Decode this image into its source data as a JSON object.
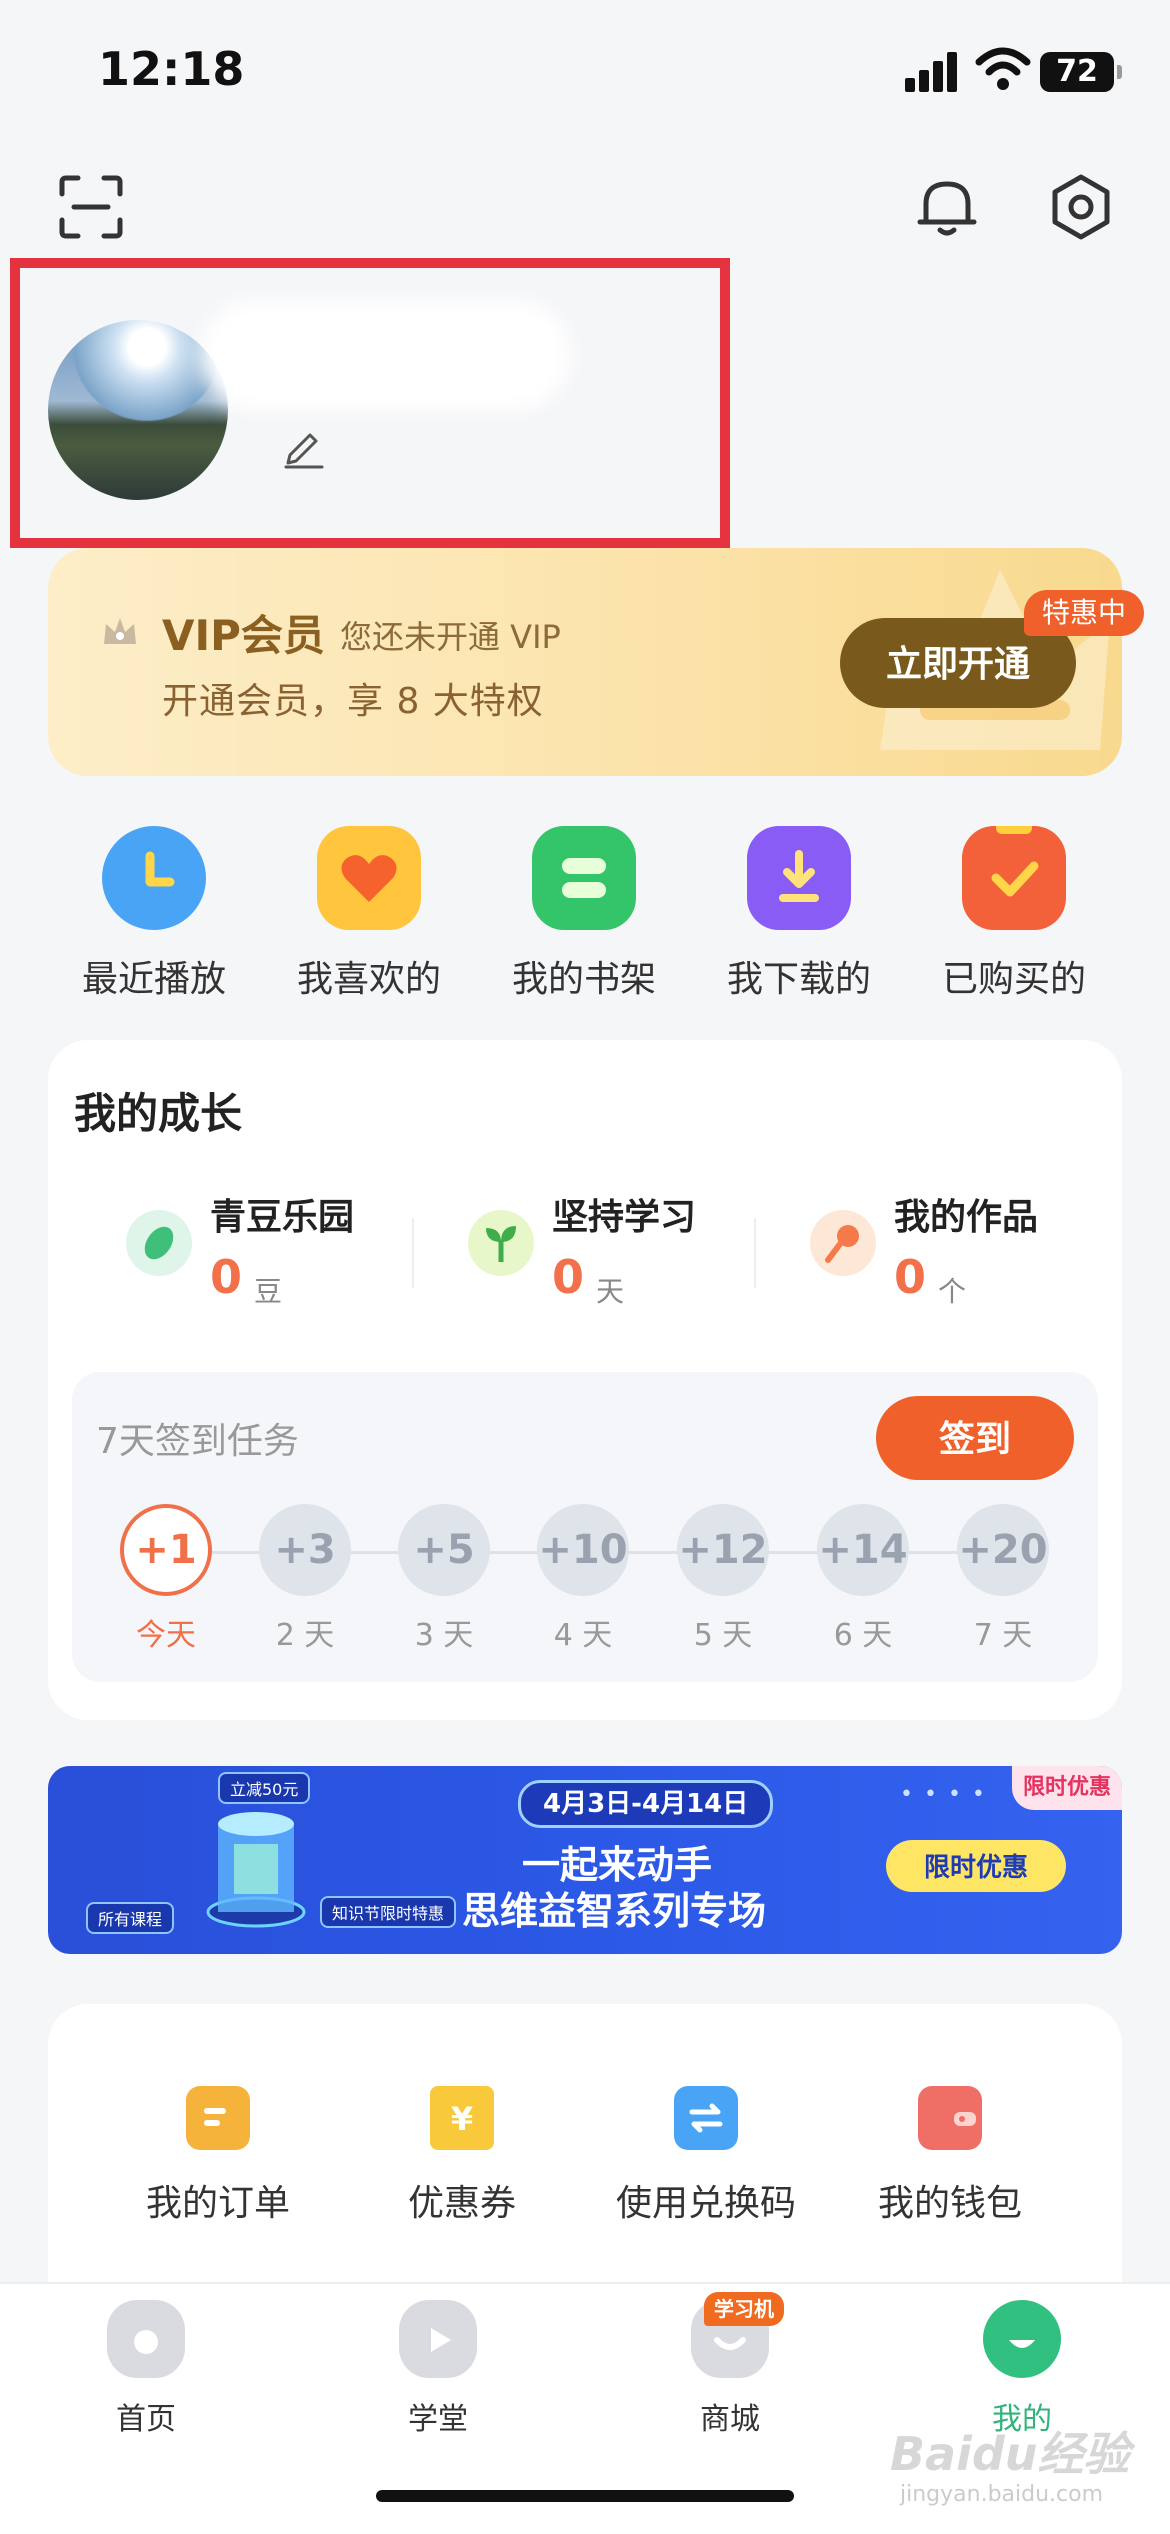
{
  "status_bar": {
    "time": "12:18",
    "battery": "72"
  },
  "vip": {
    "title": "VIP会员",
    "status": "您还未开通 VIP",
    "desc": "开通会员，享 8 大特权",
    "button": "立即开通",
    "tag": "特惠中"
  },
  "shortcuts": [
    {
      "label": "最近播放",
      "icon": "clock-icon",
      "color": "#4aa4f5"
    },
    {
      "label": "我喜欢的",
      "icon": "heart-icon",
      "color": "#ffc53d"
    },
    {
      "label": "我的书架",
      "icon": "bookshelf-icon",
      "color": "#34c56a"
    },
    {
      "label": "我下载的",
      "icon": "download-icon",
      "color": "#8a5cf6"
    },
    {
      "label": "已购买的",
      "icon": "check-bag-icon",
      "color": "#f3613a"
    }
  ],
  "growth": {
    "title": "我的成长",
    "stats": [
      {
        "name": "青豆乐园",
        "value": "0",
        "unit": "豆",
        "icon": "bean-icon"
      },
      {
        "name": "坚持学习",
        "value": "0",
        "unit": "天",
        "icon": "sprout-icon"
      },
      {
        "name": "我的作品",
        "value": "0",
        "unit": "个",
        "icon": "microphone-icon"
      }
    ],
    "checkin": {
      "title": "7天签到任务",
      "button": "签到",
      "days": [
        {
          "points": "+1",
          "label": "今天"
        },
        {
          "points": "+3",
          "label": "2 天"
        },
        {
          "points": "+5",
          "label": "3 天"
        },
        {
          "points": "+10",
          "label": "4 天"
        },
        {
          "points": "+12",
          "label": "5 天"
        },
        {
          "points": "+14",
          "label": "6 天"
        },
        {
          "points": "+20",
          "label": "7 天"
        }
      ]
    }
  },
  "banner": {
    "date": "4月3日-4月14日",
    "line1": "一起来动手",
    "line2": "思维益智系列专场",
    "button": "限时优惠",
    "tag": "限时优惠",
    "small1": "立减50元",
    "small2": "所有课程",
    "small3": "知识节限时特惠"
  },
  "services": [
    {
      "label": "我的订单",
      "icon": "order-icon",
      "color": "#f5b33b"
    },
    {
      "label": "优惠券",
      "icon": "coupon-icon",
      "color": "#f8c93a"
    },
    {
      "label": "使用兑换码",
      "icon": "exchange-icon",
      "color": "#4aa4f5"
    },
    {
      "label": "我的钱包",
      "icon": "wallet-icon",
      "color": "#ef6f66"
    }
  ],
  "tabs": [
    {
      "label": "首页",
      "icon": "home-icon"
    },
    {
      "label": "学堂",
      "icon": "play-tv-icon"
    },
    {
      "label": "商城",
      "icon": "shop-icon",
      "badge": "学习机"
    },
    {
      "label": "我的",
      "icon": "profile-face-icon",
      "active": true
    }
  ],
  "watermark": {
    "text": "Baidu经验",
    "sub": "jingyan.baidu.com"
  }
}
